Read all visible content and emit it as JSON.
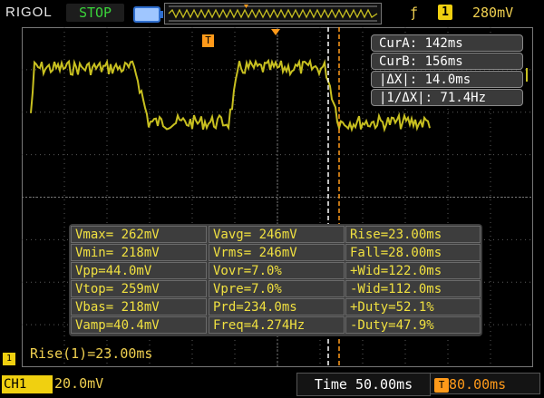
{
  "topbar": {
    "brand": "RIGOL",
    "run_state": "STOP",
    "trigger_source": "1",
    "trigger_level": "280mV"
  },
  "cursors": {
    "cur_a": "CurA: 142ms",
    "cur_b": "CurB: 156ms",
    "delta_x": "|ΔX|: 14.0ms",
    "inv_delta_x": "|1/ΔX|: 71.4Hz"
  },
  "measurements": [
    [
      "Vmax= 262mV",
      "Vavg= 246mV",
      "Rise=23.00ms"
    ],
    [
      "Vmin= 218mV",
      "Vrms= 246mV",
      "Fall=28.00ms"
    ],
    [
      "Vpp=44.0mV",
      "Vovr=7.0%",
      "+Wid=122.0ms"
    ],
    [
      "Vtop= 259mV",
      "Vpre=7.0%",
      "-Wid=112.0ms"
    ],
    [
      "Vbas= 218mV",
      "Prd=234.0ms",
      "+Duty=52.1%"
    ],
    [
      "Vamp=40.4mV",
      "Freq=4.274Hz",
      "-Duty=47.9%"
    ]
  ],
  "rise_readout": "Rise(1)=23.00ms",
  "bottombar": {
    "channel": "CH1",
    "channel_scale": "20.0mV",
    "timebase": "Time 50.00ms",
    "trigger_offset": "80.00ms"
  },
  "trigger_marker": "T",
  "channel_marker": "1",
  "colors": {
    "trace": "#c8c020",
    "grid": "#5a5a5a",
    "trigger": "#ff9a1a",
    "channel": "#f0d010",
    "run_state": "#3ad43a"
  }
}
